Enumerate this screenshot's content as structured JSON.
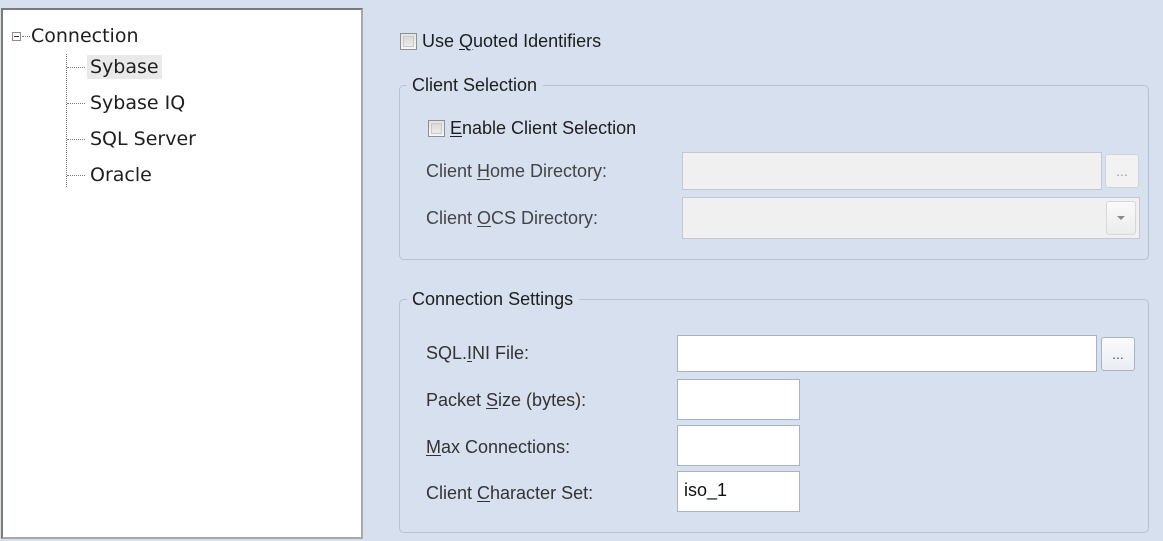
{
  "tree": {
    "root": "Connection",
    "children": [
      "Sybase",
      "Sybase IQ",
      "SQL Server",
      "Oracle"
    ],
    "selected": "Sybase"
  },
  "options": {
    "use_quoted_identifiers": {
      "label_pre": "Use ",
      "label_accel": "Q",
      "label_post": "uoted Identifiers",
      "checked": false
    }
  },
  "client_selection": {
    "title": "Client Selection",
    "enable": {
      "label_pre": "",
      "label_accel": "E",
      "label_post": "nable Client Selection",
      "checked": false
    },
    "home_directory": {
      "label_pre": "Client ",
      "label_accel": "H",
      "label_post": "ome Directory:",
      "value": "",
      "browse_label": "..."
    },
    "ocs_directory": {
      "label_pre": "Client ",
      "label_accel": "O",
      "label_post": "CS Directory:",
      "value": ""
    }
  },
  "connection_settings": {
    "title": "Connection Settings",
    "sql_ini": {
      "label_pre": "SQL.",
      "label_accel": "I",
      "label_post": "NI File:",
      "value": "",
      "browse_label": "..."
    },
    "packet_size": {
      "label_pre": "Packet ",
      "label_accel": "S",
      "label_post": "ize (bytes):",
      "value": ""
    },
    "max_connections": {
      "label_pre": "",
      "label_accel": "M",
      "label_post": "ax Connections:",
      "value": ""
    },
    "character_set": {
      "label_pre": "Client ",
      "label_accel": "C",
      "label_post": "haracter Set:",
      "value": "iso_1"
    }
  },
  "colors": {
    "background": "#d6e0ee",
    "group_border": "#b7c2d2",
    "tree_selected": "#e9e9e9"
  }
}
